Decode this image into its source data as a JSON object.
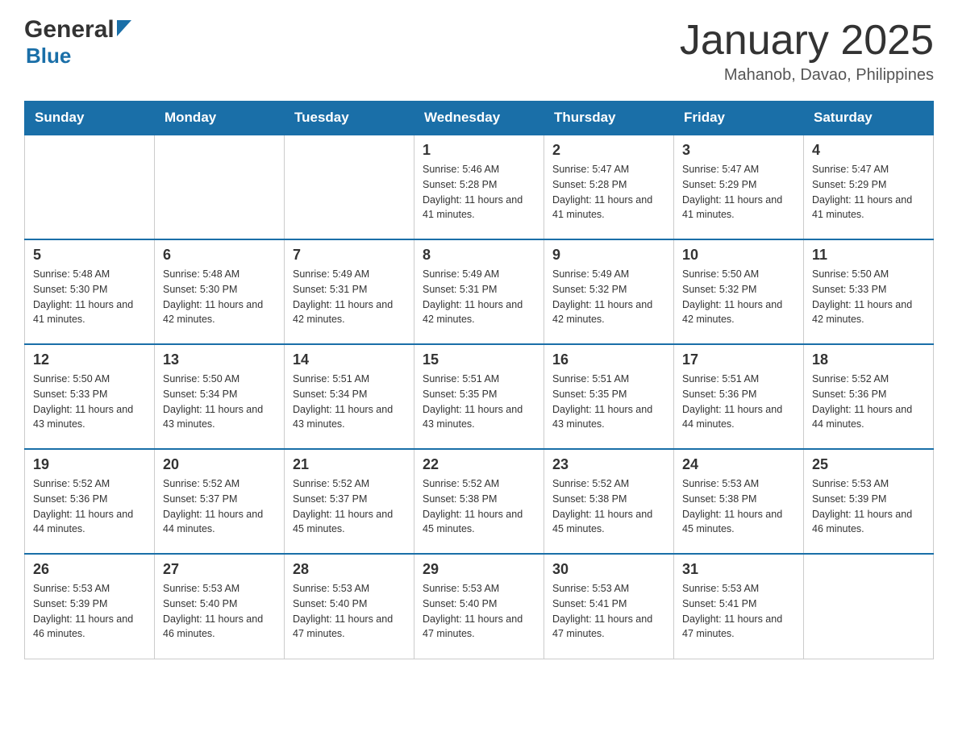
{
  "header": {
    "logo": {
      "general": "General",
      "blue": "Blue"
    },
    "title": "January 2025",
    "subtitle": "Mahanob, Davao, Philippines"
  },
  "weekdays": [
    "Sunday",
    "Monday",
    "Tuesday",
    "Wednesday",
    "Thursday",
    "Friday",
    "Saturday"
  ],
  "weeks": [
    {
      "days": [
        {
          "number": "",
          "sunrise": "",
          "sunset": "",
          "daylight": ""
        },
        {
          "number": "",
          "sunrise": "",
          "sunset": "",
          "daylight": ""
        },
        {
          "number": "",
          "sunrise": "",
          "sunset": "",
          "daylight": ""
        },
        {
          "number": "1",
          "sunrise": "Sunrise: 5:46 AM",
          "sunset": "Sunset: 5:28 PM",
          "daylight": "Daylight: 11 hours and 41 minutes."
        },
        {
          "number": "2",
          "sunrise": "Sunrise: 5:47 AM",
          "sunset": "Sunset: 5:28 PM",
          "daylight": "Daylight: 11 hours and 41 minutes."
        },
        {
          "number": "3",
          "sunrise": "Sunrise: 5:47 AM",
          "sunset": "Sunset: 5:29 PM",
          "daylight": "Daylight: 11 hours and 41 minutes."
        },
        {
          "number": "4",
          "sunrise": "Sunrise: 5:47 AM",
          "sunset": "Sunset: 5:29 PM",
          "daylight": "Daylight: 11 hours and 41 minutes."
        }
      ]
    },
    {
      "days": [
        {
          "number": "5",
          "sunrise": "Sunrise: 5:48 AM",
          "sunset": "Sunset: 5:30 PM",
          "daylight": "Daylight: 11 hours and 41 minutes."
        },
        {
          "number": "6",
          "sunrise": "Sunrise: 5:48 AM",
          "sunset": "Sunset: 5:30 PM",
          "daylight": "Daylight: 11 hours and 42 minutes."
        },
        {
          "number": "7",
          "sunrise": "Sunrise: 5:49 AM",
          "sunset": "Sunset: 5:31 PM",
          "daylight": "Daylight: 11 hours and 42 minutes."
        },
        {
          "number": "8",
          "sunrise": "Sunrise: 5:49 AM",
          "sunset": "Sunset: 5:31 PM",
          "daylight": "Daylight: 11 hours and 42 minutes."
        },
        {
          "number": "9",
          "sunrise": "Sunrise: 5:49 AM",
          "sunset": "Sunset: 5:32 PM",
          "daylight": "Daylight: 11 hours and 42 minutes."
        },
        {
          "number": "10",
          "sunrise": "Sunrise: 5:50 AM",
          "sunset": "Sunset: 5:32 PM",
          "daylight": "Daylight: 11 hours and 42 minutes."
        },
        {
          "number": "11",
          "sunrise": "Sunrise: 5:50 AM",
          "sunset": "Sunset: 5:33 PM",
          "daylight": "Daylight: 11 hours and 42 minutes."
        }
      ]
    },
    {
      "days": [
        {
          "number": "12",
          "sunrise": "Sunrise: 5:50 AM",
          "sunset": "Sunset: 5:33 PM",
          "daylight": "Daylight: 11 hours and 43 minutes."
        },
        {
          "number": "13",
          "sunrise": "Sunrise: 5:50 AM",
          "sunset": "Sunset: 5:34 PM",
          "daylight": "Daylight: 11 hours and 43 minutes."
        },
        {
          "number": "14",
          "sunrise": "Sunrise: 5:51 AM",
          "sunset": "Sunset: 5:34 PM",
          "daylight": "Daylight: 11 hours and 43 minutes."
        },
        {
          "number": "15",
          "sunrise": "Sunrise: 5:51 AM",
          "sunset": "Sunset: 5:35 PM",
          "daylight": "Daylight: 11 hours and 43 minutes."
        },
        {
          "number": "16",
          "sunrise": "Sunrise: 5:51 AM",
          "sunset": "Sunset: 5:35 PM",
          "daylight": "Daylight: 11 hours and 43 minutes."
        },
        {
          "number": "17",
          "sunrise": "Sunrise: 5:51 AM",
          "sunset": "Sunset: 5:36 PM",
          "daylight": "Daylight: 11 hours and 44 minutes."
        },
        {
          "number": "18",
          "sunrise": "Sunrise: 5:52 AM",
          "sunset": "Sunset: 5:36 PM",
          "daylight": "Daylight: 11 hours and 44 minutes."
        }
      ]
    },
    {
      "days": [
        {
          "number": "19",
          "sunrise": "Sunrise: 5:52 AM",
          "sunset": "Sunset: 5:36 PM",
          "daylight": "Daylight: 11 hours and 44 minutes."
        },
        {
          "number": "20",
          "sunrise": "Sunrise: 5:52 AM",
          "sunset": "Sunset: 5:37 PM",
          "daylight": "Daylight: 11 hours and 44 minutes."
        },
        {
          "number": "21",
          "sunrise": "Sunrise: 5:52 AM",
          "sunset": "Sunset: 5:37 PM",
          "daylight": "Daylight: 11 hours and 45 minutes."
        },
        {
          "number": "22",
          "sunrise": "Sunrise: 5:52 AM",
          "sunset": "Sunset: 5:38 PM",
          "daylight": "Daylight: 11 hours and 45 minutes."
        },
        {
          "number": "23",
          "sunrise": "Sunrise: 5:52 AM",
          "sunset": "Sunset: 5:38 PM",
          "daylight": "Daylight: 11 hours and 45 minutes."
        },
        {
          "number": "24",
          "sunrise": "Sunrise: 5:53 AM",
          "sunset": "Sunset: 5:38 PM",
          "daylight": "Daylight: 11 hours and 45 minutes."
        },
        {
          "number": "25",
          "sunrise": "Sunrise: 5:53 AM",
          "sunset": "Sunset: 5:39 PM",
          "daylight": "Daylight: 11 hours and 46 minutes."
        }
      ]
    },
    {
      "days": [
        {
          "number": "26",
          "sunrise": "Sunrise: 5:53 AM",
          "sunset": "Sunset: 5:39 PM",
          "daylight": "Daylight: 11 hours and 46 minutes."
        },
        {
          "number": "27",
          "sunrise": "Sunrise: 5:53 AM",
          "sunset": "Sunset: 5:40 PM",
          "daylight": "Daylight: 11 hours and 46 minutes."
        },
        {
          "number": "28",
          "sunrise": "Sunrise: 5:53 AM",
          "sunset": "Sunset: 5:40 PM",
          "daylight": "Daylight: 11 hours and 47 minutes."
        },
        {
          "number": "29",
          "sunrise": "Sunrise: 5:53 AM",
          "sunset": "Sunset: 5:40 PM",
          "daylight": "Daylight: 11 hours and 47 minutes."
        },
        {
          "number": "30",
          "sunrise": "Sunrise: 5:53 AM",
          "sunset": "Sunset: 5:41 PM",
          "daylight": "Daylight: 11 hours and 47 minutes."
        },
        {
          "number": "31",
          "sunrise": "Sunrise: 5:53 AM",
          "sunset": "Sunset: 5:41 PM",
          "daylight": "Daylight: 11 hours and 47 minutes."
        },
        {
          "number": "",
          "sunrise": "",
          "sunset": "",
          "daylight": ""
        }
      ]
    }
  ]
}
